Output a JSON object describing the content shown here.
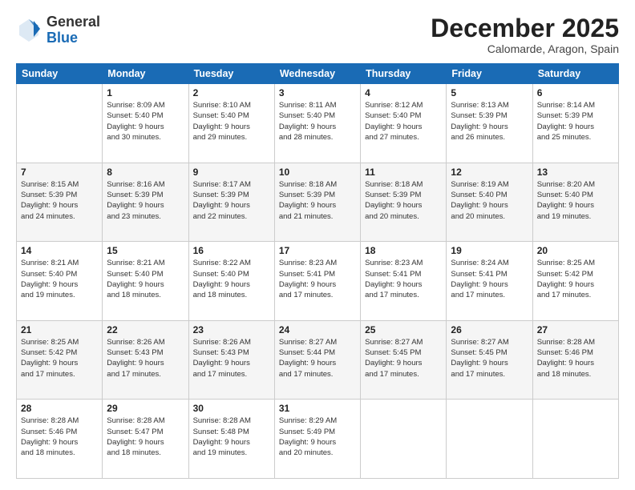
{
  "header": {
    "logo_general": "General",
    "logo_blue": "Blue",
    "month_title": "December 2025",
    "location": "Calomarde, Aragon, Spain"
  },
  "weekdays": [
    "Sunday",
    "Monday",
    "Tuesday",
    "Wednesday",
    "Thursday",
    "Friday",
    "Saturday"
  ],
  "weeks": [
    [
      {
        "day": "",
        "info": ""
      },
      {
        "day": "1",
        "info": "Sunrise: 8:09 AM\nSunset: 5:40 PM\nDaylight: 9 hours\nand 30 minutes."
      },
      {
        "day": "2",
        "info": "Sunrise: 8:10 AM\nSunset: 5:40 PM\nDaylight: 9 hours\nand 29 minutes."
      },
      {
        "day": "3",
        "info": "Sunrise: 8:11 AM\nSunset: 5:40 PM\nDaylight: 9 hours\nand 28 minutes."
      },
      {
        "day": "4",
        "info": "Sunrise: 8:12 AM\nSunset: 5:40 PM\nDaylight: 9 hours\nand 27 minutes."
      },
      {
        "day": "5",
        "info": "Sunrise: 8:13 AM\nSunset: 5:39 PM\nDaylight: 9 hours\nand 26 minutes."
      },
      {
        "day": "6",
        "info": "Sunrise: 8:14 AM\nSunset: 5:39 PM\nDaylight: 9 hours\nand 25 minutes."
      }
    ],
    [
      {
        "day": "7",
        "info": "Sunrise: 8:15 AM\nSunset: 5:39 PM\nDaylight: 9 hours\nand 24 minutes."
      },
      {
        "day": "8",
        "info": "Sunrise: 8:16 AM\nSunset: 5:39 PM\nDaylight: 9 hours\nand 23 minutes."
      },
      {
        "day": "9",
        "info": "Sunrise: 8:17 AM\nSunset: 5:39 PM\nDaylight: 9 hours\nand 22 minutes."
      },
      {
        "day": "10",
        "info": "Sunrise: 8:18 AM\nSunset: 5:39 PM\nDaylight: 9 hours\nand 21 minutes."
      },
      {
        "day": "11",
        "info": "Sunrise: 8:18 AM\nSunset: 5:39 PM\nDaylight: 9 hours\nand 20 minutes."
      },
      {
        "day": "12",
        "info": "Sunrise: 8:19 AM\nSunset: 5:40 PM\nDaylight: 9 hours\nand 20 minutes."
      },
      {
        "day": "13",
        "info": "Sunrise: 8:20 AM\nSunset: 5:40 PM\nDaylight: 9 hours\nand 19 minutes."
      }
    ],
    [
      {
        "day": "14",
        "info": "Sunrise: 8:21 AM\nSunset: 5:40 PM\nDaylight: 9 hours\nand 19 minutes."
      },
      {
        "day": "15",
        "info": "Sunrise: 8:21 AM\nSunset: 5:40 PM\nDaylight: 9 hours\nand 18 minutes."
      },
      {
        "day": "16",
        "info": "Sunrise: 8:22 AM\nSunset: 5:40 PM\nDaylight: 9 hours\nand 18 minutes."
      },
      {
        "day": "17",
        "info": "Sunrise: 8:23 AM\nSunset: 5:41 PM\nDaylight: 9 hours\nand 17 minutes."
      },
      {
        "day": "18",
        "info": "Sunrise: 8:23 AM\nSunset: 5:41 PM\nDaylight: 9 hours\nand 17 minutes."
      },
      {
        "day": "19",
        "info": "Sunrise: 8:24 AM\nSunset: 5:41 PM\nDaylight: 9 hours\nand 17 minutes."
      },
      {
        "day": "20",
        "info": "Sunrise: 8:25 AM\nSunset: 5:42 PM\nDaylight: 9 hours\nand 17 minutes."
      }
    ],
    [
      {
        "day": "21",
        "info": "Sunrise: 8:25 AM\nSunset: 5:42 PM\nDaylight: 9 hours\nand 17 minutes."
      },
      {
        "day": "22",
        "info": "Sunrise: 8:26 AM\nSunset: 5:43 PM\nDaylight: 9 hours\nand 17 minutes."
      },
      {
        "day": "23",
        "info": "Sunrise: 8:26 AM\nSunset: 5:43 PM\nDaylight: 9 hours\nand 17 minutes."
      },
      {
        "day": "24",
        "info": "Sunrise: 8:27 AM\nSunset: 5:44 PM\nDaylight: 9 hours\nand 17 minutes."
      },
      {
        "day": "25",
        "info": "Sunrise: 8:27 AM\nSunset: 5:45 PM\nDaylight: 9 hours\nand 17 minutes."
      },
      {
        "day": "26",
        "info": "Sunrise: 8:27 AM\nSunset: 5:45 PM\nDaylight: 9 hours\nand 17 minutes."
      },
      {
        "day": "27",
        "info": "Sunrise: 8:28 AM\nSunset: 5:46 PM\nDaylight: 9 hours\nand 18 minutes."
      }
    ],
    [
      {
        "day": "28",
        "info": "Sunrise: 8:28 AM\nSunset: 5:46 PM\nDaylight: 9 hours\nand 18 minutes."
      },
      {
        "day": "29",
        "info": "Sunrise: 8:28 AM\nSunset: 5:47 PM\nDaylight: 9 hours\nand 18 minutes."
      },
      {
        "day": "30",
        "info": "Sunrise: 8:28 AM\nSunset: 5:48 PM\nDaylight: 9 hours\nand 19 minutes."
      },
      {
        "day": "31",
        "info": "Sunrise: 8:29 AM\nSunset: 5:49 PM\nDaylight: 9 hours\nand 20 minutes."
      },
      {
        "day": "",
        "info": ""
      },
      {
        "day": "",
        "info": ""
      },
      {
        "day": "",
        "info": ""
      }
    ]
  ]
}
